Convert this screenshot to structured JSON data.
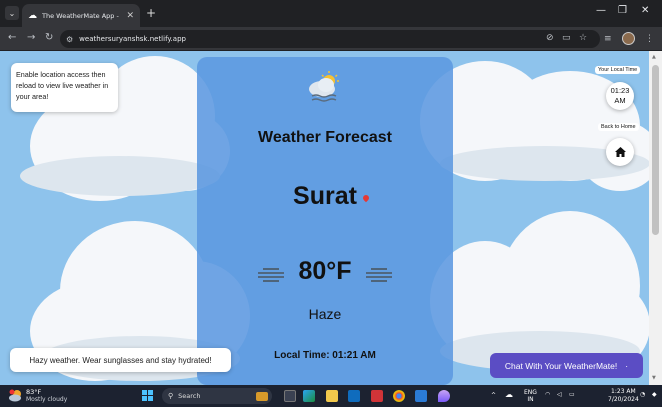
{
  "browser": {
    "tab_title": "The WeatherMate App - Real-Ti",
    "url": "weathersuryanshsk.netlify.app"
  },
  "page": {
    "location_notice": "Enable location access then reload to view live weather in your area!",
    "title": "Weather Forecast",
    "city": "Surat",
    "temperature": "80°F",
    "condition": "Haze",
    "local_time": "Local Time: 01:21 AM",
    "tip": "Hazy weather. Wear sunglasses and stay hydrated!",
    "your_local_time_label": "Your Local Time",
    "local_clock_time": "01:23",
    "local_clock_ampm": "AM",
    "back_to_home_label": "Back to Home",
    "chat_button_label": "Chat With Your WeatherMate!"
  },
  "taskbar": {
    "weather_temp": "83°F",
    "weather_condition": "Mostly cloudy",
    "search_placeholder": "Search",
    "lang_line1": "ENG",
    "lang_line2": "IN",
    "time": "1:23 AM",
    "date": "7/20/2024"
  },
  "colors": {
    "sky": "#8ec3ec",
    "panel": "#5c98e0",
    "chat_button": "#5b4dc4",
    "location_pin": "#e53935"
  }
}
